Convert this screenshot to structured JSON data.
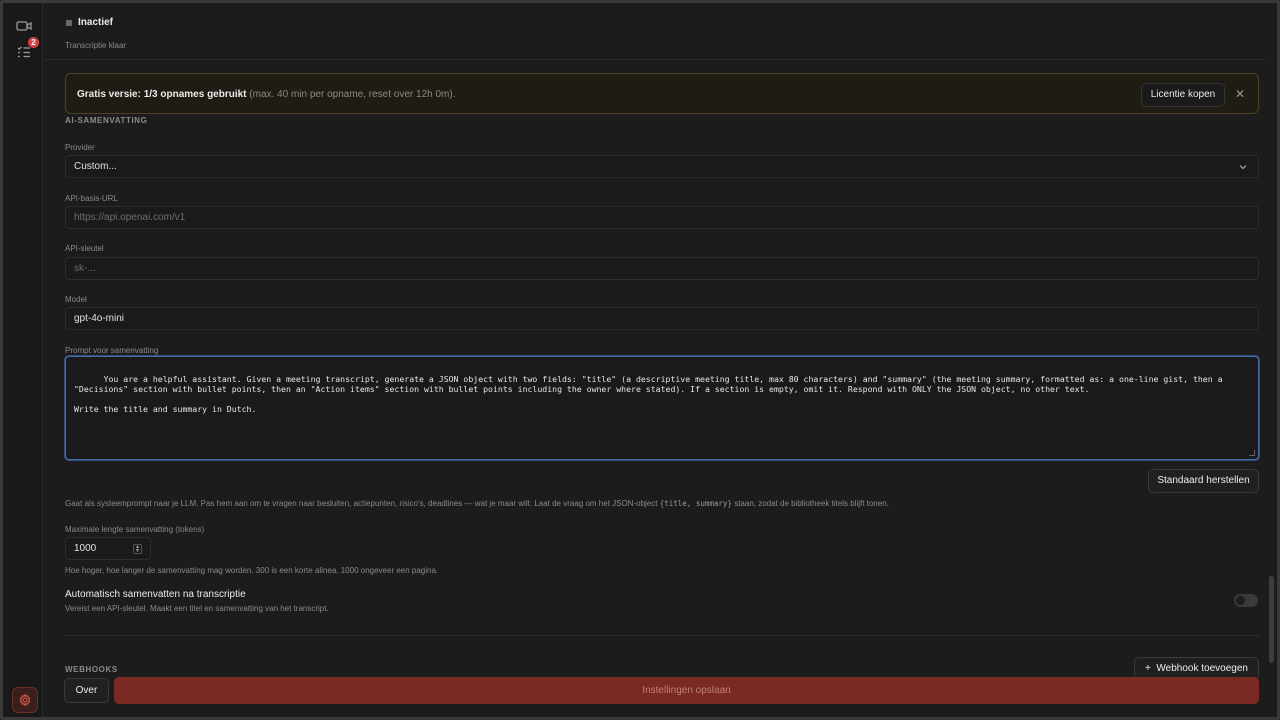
{
  "sidebar": {
    "badge_count": "2",
    "icons": [
      "video-icon",
      "task-list-icon",
      "settings-icon"
    ]
  },
  "header": {
    "status": "Inactief",
    "subtitle": "Transcriptie klaar"
  },
  "banner": {
    "bold": "Gratis versie: 1/3 opnames gebruikt",
    "muted": " (max. 40 min per opname, reset over 12h 0m).",
    "button": "Licentie kopen",
    "close_icon": "close-icon"
  },
  "ai_summary": {
    "section_title": "AI-SAMENVATTING",
    "provider_label": "Provider",
    "provider_value": "Custom...",
    "api_url_label": "API-basis-URL",
    "api_url_placeholder": "https://api.openai.com/v1",
    "api_key_label": "API-sleutel",
    "api_key_placeholder": "sk-...",
    "model_label": "Model",
    "model_value": "gpt-4o-mini",
    "prompt_label": "Prompt voor samenvatting",
    "prompt_value": "You are a helpful assistant. Given a meeting transcript, generate a JSON object with two fields: \"title\" (a descriptive meeting title, max 80 characters) and \"summary\" (the meeting summary, formatted as: a one-line gist, then a \"Decisions\" section with bullet points, then an \"Action items\" section with bullet points including the owner where stated). If a section is empty, omit it. Respond with ONLY the JSON object, no other text.\n\nWrite the title and summary in Dutch.",
    "reset_button": "Standaard herstellen",
    "prompt_hint_before": "Gaat als systeemprompt naar je LLM. Pas hem aan om te vragen naar besluiten, actiepunten, risico's, deadlines — wat je maar wilt. Laat de vraag om het JSON-object ",
    "prompt_hint_code": "{title, summary}",
    "prompt_hint_after": " staan, zodat de bibliotheek titels blijft tonen.",
    "max_tokens_label": "Maximale lengte samenvatting (tokens)",
    "max_tokens_value": "1000",
    "max_tokens_hint": "Hoe hoger, hoe langer de samenvatting mag worden. 300 is een korte alinea, 1000 ongeveer een pagina.",
    "auto_title": "Automatisch samenvatten na transcriptie",
    "auto_hint": "Vereist een API-sleutel. Maakt een titel en samenvatting van het transcript.",
    "auto_enabled": false
  },
  "webhooks": {
    "section_title": "WEBHOOKS",
    "add_button": "Webhook toevoegen"
  },
  "footer": {
    "about_button": "Over",
    "save_button": "Instellingen opslaan"
  }
}
